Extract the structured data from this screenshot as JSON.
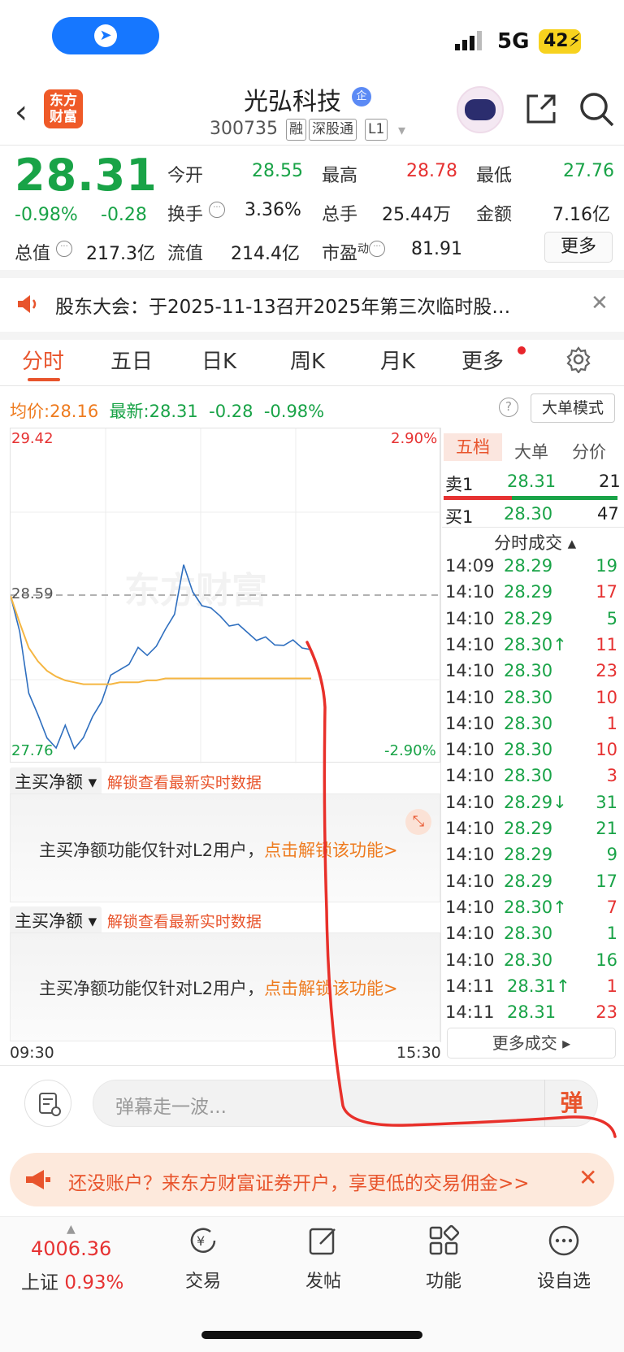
{
  "status_bar": {
    "network": "5G",
    "battery": "42"
  },
  "header": {
    "logo_text": "东方财富",
    "stock_name": "光弘科技",
    "qi_badge": "企",
    "stock_code": "300735",
    "tags": [
      "融",
      "深股通",
      "L1"
    ]
  },
  "quote": {
    "price": "28.31",
    "change_pct": "-0.98%",
    "change": "-0.28",
    "open_label": "今开",
    "open": "28.55",
    "high_label": "最高",
    "high": "28.78",
    "low_label": "最低",
    "low": "27.76",
    "turnover_label": "换手",
    "turnover": "3.36%",
    "volume_label": "总手",
    "volume": "25.44万",
    "amount_label": "金额",
    "amount": "7.16亿",
    "mktcap_label": "总值",
    "mktcap": "217.3亿",
    "float_label": "流值",
    "float": "214.4亿",
    "pe_label": "市盈",
    "pe_sup": "动",
    "pe": "81.91",
    "more": "更多"
  },
  "notice": {
    "text": "股东大会：于2025-11-13召开2025年第三次临时股…"
  },
  "tabs": [
    "分时",
    "五日",
    "日K",
    "周K",
    "月K",
    "更多"
  ],
  "avg_bar": {
    "avg_label": "均价:",
    "avg": "28.16",
    "latest_label": "最新:",
    "latest": "28.31",
    "chg": "-0.28",
    "pct": "-0.98%",
    "big_order_btn": "大单模式"
  },
  "chart": {
    "y_top": "29.42",
    "y_mid": "28.59",
    "y_bot": "27.76",
    "pct_top": "2.90%",
    "pct_bot": "-2.90%",
    "time_start": "09:30",
    "time_end": "15:30",
    "watermark": "东方财富"
  },
  "chart_data": {
    "type": "line",
    "series": [
      {
        "values": [
          28.59,
          28.4,
          28.1,
          27.95,
          27.85,
          27.82,
          27.9,
          27.8,
          27.88,
          27.95,
          28.05,
          28.15,
          28.2,
          28.25,
          28.3,
          28.28,
          28.35,
          28.4,
          28.5,
          28.78,
          28.6,
          28.55,
          28.5,
          28.48,
          28.45,
          28.42,
          28.4,
          28.38,
          28.36,
          28.34,
          28.36,
          28.35,
          28.33,
          28.31
        ]
      },
      {
        "values": [
          28.59,
          28.45,
          28.32,
          28.25,
          28.2,
          28.17,
          28.15,
          28.14,
          28.13,
          28.13,
          28.13,
          28.13,
          28.14,
          28.14,
          28.14,
          28.15,
          28.15,
          28.16,
          28.16,
          28.16,
          28.16,
          28.16,
          28.16,
          28.16,
          28.16,
          28.16,
          28.16,
          28.16,
          28.16,
          28.16,
          28.16,
          28.16,
          28.16,
          28.16
        ]
      }
    ],
    "ylim": [
      27.76,
      29.42
    ],
    "xlabel": "",
    "ylabel": ""
  },
  "orderbook": {
    "tabs": [
      "五档",
      "大单",
      "分价"
    ],
    "ask1_label": "卖1",
    "ask1_price": "28.31",
    "ask1_vol": "21",
    "bid1_label": "买1",
    "bid1_price": "28.30",
    "bid1_vol": "47",
    "trades_title": "分时成交",
    "trades": [
      {
        "t": "14:09",
        "p": "28.29",
        "v": "19",
        "pc": "green",
        "vc": "green",
        "arrow": ""
      },
      {
        "t": "14:10",
        "p": "28.29",
        "v": "17",
        "pc": "green",
        "vc": "red",
        "arrow": ""
      },
      {
        "t": "14:10",
        "p": "28.29",
        "v": "5",
        "pc": "green",
        "vc": "green",
        "arrow": ""
      },
      {
        "t": "14:10",
        "p": "28.30",
        "v": "11",
        "pc": "green",
        "vc": "red",
        "arrow": "↑"
      },
      {
        "t": "14:10",
        "p": "28.30",
        "v": "23",
        "pc": "green",
        "vc": "red",
        "arrow": ""
      },
      {
        "t": "14:10",
        "p": "28.30",
        "v": "10",
        "pc": "green",
        "vc": "red",
        "arrow": ""
      },
      {
        "t": "14:10",
        "p": "28.30",
        "v": "1",
        "pc": "green",
        "vc": "red",
        "arrow": ""
      },
      {
        "t": "14:10",
        "p": "28.30",
        "v": "10",
        "pc": "green",
        "vc": "red",
        "arrow": ""
      },
      {
        "t": "14:10",
        "p": "28.30",
        "v": "3",
        "pc": "green",
        "vc": "red",
        "arrow": ""
      },
      {
        "t": "14:10",
        "p": "28.29",
        "v": "31",
        "pc": "green",
        "vc": "green",
        "arrow": "↓"
      },
      {
        "t": "14:10",
        "p": "28.29",
        "v": "21",
        "pc": "green",
        "vc": "green",
        "arrow": ""
      },
      {
        "t": "14:10",
        "p": "28.29",
        "v": "9",
        "pc": "green",
        "vc": "green",
        "arrow": ""
      },
      {
        "t": "14:10",
        "p": "28.29",
        "v": "17",
        "pc": "green",
        "vc": "green",
        "arrow": ""
      },
      {
        "t": "14:10",
        "p": "28.30",
        "v": "7",
        "pc": "green",
        "vc": "red",
        "arrow": "↑"
      },
      {
        "t": "14:10",
        "p": "28.30",
        "v": "1",
        "pc": "green",
        "vc": "green",
        "arrow": ""
      },
      {
        "t": "14:10",
        "p": "28.30",
        "v": "16",
        "pc": "green",
        "vc": "green",
        "arrow": ""
      },
      {
        "t": "14:11",
        "p": "28.31",
        "v": "1",
        "pc": "green",
        "vc": "red",
        "arrow": "↑"
      },
      {
        "t": "14:11",
        "p": "28.31",
        "v": "23",
        "pc": "green",
        "vc": "red",
        "arrow": ""
      }
    ],
    "more_trades": "更多成交 ▸"
  },
  "main_buy": {
    "selector": "主买净额",
    "unlock_link": "解锁查看最新实时数据",
    "panel_text": "主买净额功能仅针对L2用户，",
    "panel_link": "点击解锁该功能>"
  },
  "danmu": {
    "placeholder": "弹幕走一波...",
    "button": "弹"
  },
  "promo": {
    "text": "还没账户？来东方财富证券开户，享更低的交易佣金>>"
  },
  "bottom_nav": {
    "index_value": "4006.36",
    "index_name": "上证",
    "index_pct": "0.93%",
    "items": [
      "交易",
      "发帖",
      "功能",
      "设自选"
    ]
  },
  "colors": {
    "up": "#e63232",
    "down": "#19a347",
    "accent": "#e8542c",
    "avg_line": "#f5b642",
    "price_line": "#2f6fbf"
  }
}
